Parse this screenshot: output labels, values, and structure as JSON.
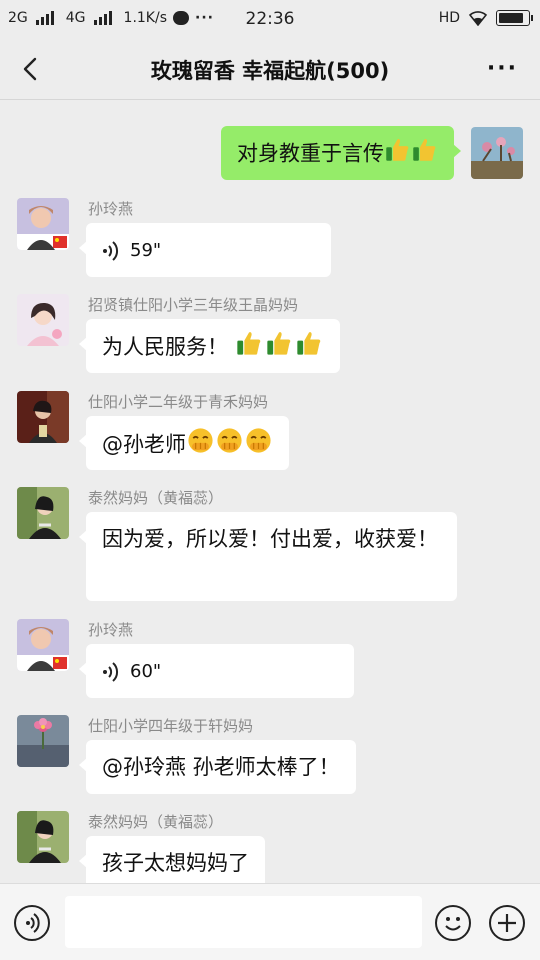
{
  "status_bar": {
    "network1": "2G",
    "network2": "4G",
    "speed": "1.1K/s",
    "more": "···",
    "time": "22:36",
    "hd": "HD",
    "battery_level": 0.85
  },
  "header": {
    "title": "玫瑰留香  幸福起航(500)",
    "back_icon": "chevron-left-icon",
    "more_icon": "more-horizontal-icon"
  },
  "messages": [
    {
      "side": "me",
      "type": "text",
      "text": "对身教重于言传",
      "emoji": "thumbs-up-icon",
      "emoji_count": 2
    },
    {
      "side": "left",
      "sender": "孙玲燕",
      "type": "voice",
      "duration": "59\""
    },
    {
      "side": "left",
      "sender": "招贤镇仕阳小学三年级王晶妈妈",
      "type": "text",
      "text": "为人民服务！",
      "emoji": "thumbs-up-icon",
      "emoji_count": 3
    },
    {
      "side": "left",
      "sender": "仕阳小学二年级于青禾妈妈",
      "type": "text",
      "text": "@孙老师",
      "emoji": "sneaky-face-icon",
      "emoji_count": 3
    },
    {
      "side": "left",
      "sender": "泰然妈妈（黄福蕊）",
      "type": "text",
      "text": "因为爱，所以爱！付出爱，收获爱！"
    },
    {
      "side": "left",
      "sender": "孙玲燕",
      "type": "voice",
      "duration": "60\""
    },
    {
      "side": "left",
      "sender": "仕阳小学四年级于轩妈妈",
      "type": "text",
      "text": "@孙玲燕  孙老师太棒了！"
    },
    {
      "side": "left",
      "sender": "泰然妈妈（黄福蕊）",
      "type": "text",
      "text": "孩子太想妈妈了"
    }
  ],
  "input_bar": {
    "voice_icon": "voice-mode-icon",
    "emoji_icon": "emoji-smile-icon",
    "plus_icon": "plus-circle-icon",
    "value": ""
  },
  "colors": {
    "background": "#ededed",
    "my_bubble": "#95ec69",
    "other_bubble": "#ffffff",
    "sender_text": "#8a8a8a"
  }
}
